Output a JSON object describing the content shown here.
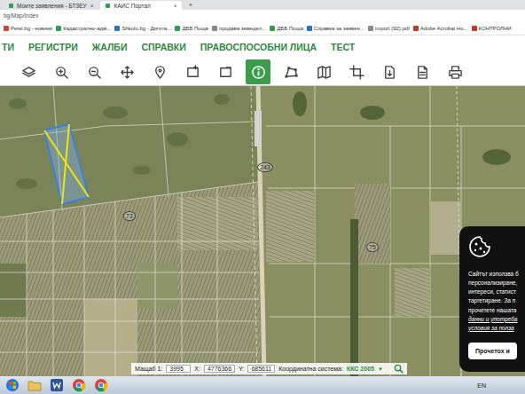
{
  "browser": {
    "tabs": [
      {
        "label": "Моите заявления - БТЗЕУ",
        "close": "×",
        "selected": false
      },
      {
        "label": "КАИС Портал",
        "close": "×",
        "selected": true
      }
    ],
    "new_tab": "+",
    "address": "bg/Map/Index"
  },
  "bookmarks": [
    {
      "label": "Petel.bg - новини",
      "color": "#d9412b"
    },
    {
      "label": "Кадастрално-адм...",
      "color": "#2e9e4f"
    },
    {
      "label": "Shkolo.bg - Дигита...",
      "color": "#2b6fd9"
    },
    {
      "label": "ДББ Поща",
      "color": "#2e9e4f"
    },
    {
      "label": "продава земедел...",
      "color": "#888888"
    },
    {
      "label": "ДББ Поща",
      "color": "#2e9e4f"
    },
    {
      "label": "Справка за заявен...",
      "color": "#2b6fd9"
    },
    {
      "label": "import (92).pdf",
      "color": "#888888"
    },
    {
      "label": "Adobe Acrobat Ho...",
      "color": "#c0392b"
    },
    {
      "label": "КОНТРОЛНИ",
      "color": "#c0392b"
    }
  ],
  "menu": [
    "ТИ",
    "РЕГИСТРИ",
    "ЖАЛБИ",
    "СПРАВКИ",
    "ПРАВОСПОСОБНИ ЛИЦА",
    "ТЕСТ"
  ],
  "toolbar": [
    {
      "kind": "layers",
      "selected": false
    },
    {
      "kind": "zoom-in",
      "selected": false
    },
    {
      "kind": "zoom-out",
      "selected": false
    },
    {
      "kind": "pan",
      "selected": false
    },
    {
      "kind": "pin",
      "selected": false
    },
    {
      "kind": "rect",
      "selected": false
    },
    {
      "kind": "rect-minus",
      "selected": false
    },
    {
      "kind": "info",
      "selected": true
    },
    {
      "kind": "polygon",
      "selected": false
    },
    {
      "kind": "map",
      "selected": false
    },
    {
      "kind": "crop",
      "selected": false
    },
    {
      "kind": "export",
      "selected": false
    },
    {
      "kind": "document",
      "selected": false
    },
    {
      "kind": "print",
      "selected": false
    }
  ],
  "map": {
    "labels": [
      "243",
      "73",
      "75"
    ]
  },
  "status": {
    "scale_label": "Мащаб 1:",
    "scale": "3995",
    "x_label": "X:",
    "x": "4776366",
    "y_label": "Y:",
    "y": "685611",
    "crs_label": "Координатна система:",
    "crs": "ККС 2005",
    "dropdown": "▼"
  },
  "cookie": {
    "lines": [
      {
        "text": "Сайтът използва б",
        "link": false
      },
      {
        "text": "персонализиране,",
        "link": false
      },
      {
        "text": "интереси, статист",
        "link": false
      },
      {
        "text": "таргетиране. За п",
        "link": false
      },
      {
        "text": "прочетете нашата",
        "link": false
      },
      {
        "text": "данни и употреба",
        "link": true
      },
      {
        "text": "условия за полза",
        "link": true
      }
    ],
    "button": "Прочетох и"
  },
  "taskbar": {
    "apps": [
      {
        "kind": "start"
      },
      {
        "kind": "explorer"
      },
      {
        "kind": "word"
      },
      {
        "kind": "chrome"
      },
      {
        "kind": "chrome"
      }
    ],
    "lang": "EN"
  }
}
